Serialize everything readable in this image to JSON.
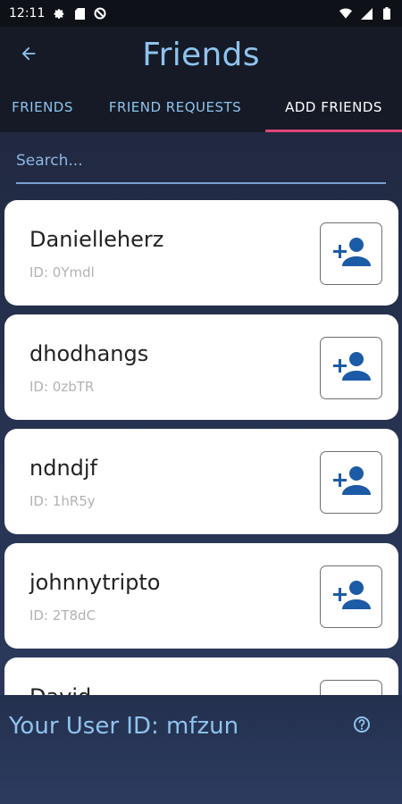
{
  "status_bar": {
    "time": "12:11",
    "left_icons": [
      "gear-icon",
      "sd-card-icon",
      "no-data-icon"
    ],
    "right_icons": [
      "wifi-icon",
      "signal-icon",
      "battery-icon"
    ]
  },
  "header": {
    "back_icon": "arrow-left-icon",
    "title": "Friends"
  },
  "tabs": [
    {
      "label": "FRIENDS",
      "active": false
    },
    {
      "label": "FRIEND REQUESTS",
      "active": false
    },
    {
      "label": "ADD FRIENDS",
      "active": true
    }
  ],
  "search": {
    "placeholder": "Search...",
    "value": ""
  },
  "users": [
    {
      "name": "Danielleherz",
      "id": "ID: 0Ymdl",
      "action_icon": "add-person-icon"
    },
    {
      "name": "dhodhangs",
      "id": "ID: 0zbTR",
      "action_icon": "add-person-icon"
    },
    {
      "name": "ndndjf",
      "id": "ID: 1hR5y",
      "action_icon": "add-person-icon"
    },
    {
      "name": "johnnytripto",
      "id": "ID: 2T8dC",
      "action_icon": "add-person-icon"
    },
    {
      "name": "David",
      "id": "",
      "action_icon": "add-person-icon"
    }
  ],
  "footer": {
    "user_id_text": "Your User ID: mfzun",
    "help_icon": "help-circle-icon"
  },
  "colors": {
    "accent_blue": "#8fc3ee",
    "tab_indicator": "#e0457b",
    "add_icon_blue": "#1c5ba6",
    "card_bg": "#ffffff"
  }
}
